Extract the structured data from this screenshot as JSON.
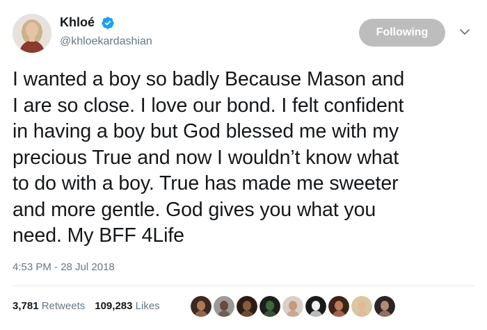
{
  "user": {
    "display_name": "Khloé",
    "handle": "@khloekardashian",
    "verified": true,
    "avatar_icon": "profile-photo"
  },
  "follow_button": {
    "label": "Following"
  },
  "more_menu_icon": "chevron-down-icon",
  "tweet": {
    "text": "I wanted a boy so badly Because Mason and\nI are so close. I love our bond. I felt confident\nin having a boy but God blessed me with my\nprecious True and now I wouldn’t know what\nto do with a boy. True has made me sweeter\nand more gentle. God gives you what you\nneed.  My BFF 4Life",
    "timestamp": "4:53 PM - 28 Jul 2018"
  },
  "stats": {
    "retweets_count": "3,781",
    "retweets_label": "Retweets",
    "likes_count": "109,283",
    "likes_label": "Likes"
  },
  "likers": [
    {
      "color": "#3a2a22",
      "skin": "#b07a55"
    },
    {
      "color": "#9a9a9a",
      "skin": "#6b4a3a"
    },
    {
      "color": "#2b1d16",
      "skin": "#8a5a3c"
    },
    {
      "color": "#1e1e1e",
      "skin": "#3c6a3a"
    },
    {
      "color": "#d8d0c8",
      "skin": "#c79a7a"
    },
    {
      "color": "#1a1a1a",
      "skin": "#f0f0f0"
    },
    {
      "color": "#3b2418",
      "skin": "#c0785a"
    },
    {
      "color": "#d9c7a0",
      "skin": "#e6b89a"
    },
    {
      "color": "#2c2424",
      "skin": "#b38a74"
    }
  ],
  "colors": {
    "text": "#14171a",
    "secondary": "#657786",
    "verified_blue": "#1da1f2",
    "button_bg": "#bdbdbd"
  }
}
